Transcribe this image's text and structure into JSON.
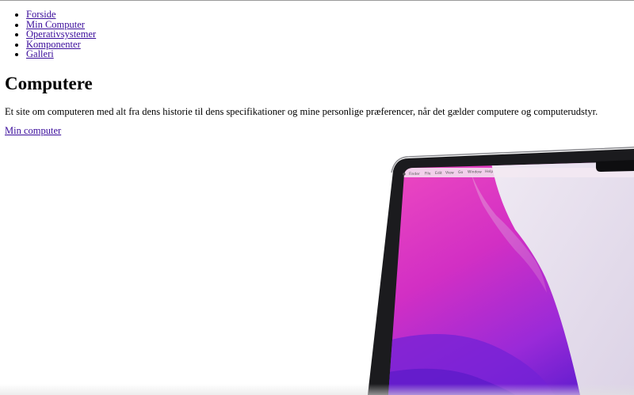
{
  "nav": {
    "items": [
      {
        "label": "Forside"
      },
      {
        "label": "Min Computer"
      },
      {
        "label": "Operativsystemer"
      },
      {
        "label": "Komponenter"
      },
      {
        "label": "Galleri"
      }
    ]
  },
  "header": {
    "title": "Computere"
  },
  "main": {
    "intro": "Et site om computeren med alt fra dens historie til dens specifikationer og mine personlige præferencer, når det gælder computere og computerudstyr.",
    "cta_label": "Min computer"
  },
  "image": {
    "subject": "laptop",
    "menubar_items": [
      "Finder",
      "File",
      "Edit",
      "View",
      "Go",
      "Window",
      "Help"
    ],
    "colors": {
      "bezel": "#1b1b1e",
      "wallpaper_pink": "#e02fb0",
      "wallpaper_purple": "#7a1fd6",
      "wallpaper_light": "#e8e2ee"
    }
  }
}
